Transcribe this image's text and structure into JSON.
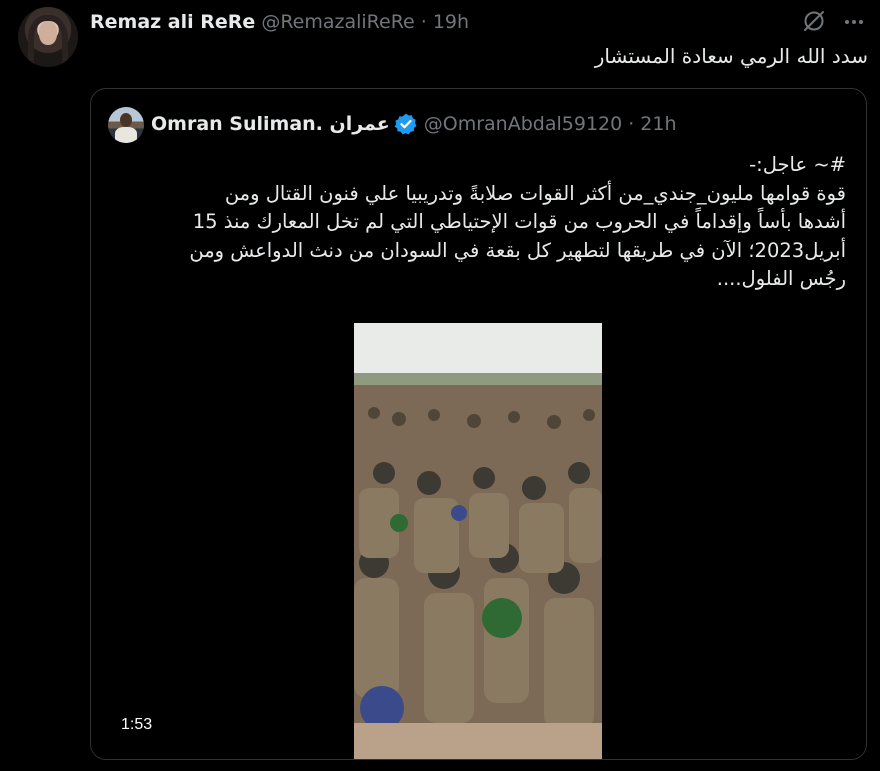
{
  "tweet": {
    "author_name": "Remaz ali ReRe",
    "author_handle": "@RemazaliReRe",
    "separator": "·",
    "time": "19h",
    "text": "سدد الله الرمي سعادة المستشار",
    "icons": {
      "grok": "grok-slash-icon",
      "more": "more-dots-icon"
    }
  },
  "quote": {
    "author_name": "Omran Suliman. عمران",
    "verified_icon": "verified-badge-icon",
    "verified_color": "#1d9bf0",
    "author_handle": "@OmranAbdal59120",
    "separator": "·",
    "time": "21h",
    "lines": [
      "#~ عاجل:-",
      "قوة قوامها مليون_جندي_من أكثر القوات صلابةً وتدريبيا علي فنون القتال ومن",
      "أشدها بأساً وإقداماً في الحروب من قوات الإحتياطي التي لم تخل المعارك منذ 15",
      "أبريل2023؛ الآن في طريقها لتطهير كل بقعة في السودان من دنث الدواعش ومن",
      "رجُس الفلول...."
    ],
    "media": {
      "duration": "1:53"
    }
  }
}
